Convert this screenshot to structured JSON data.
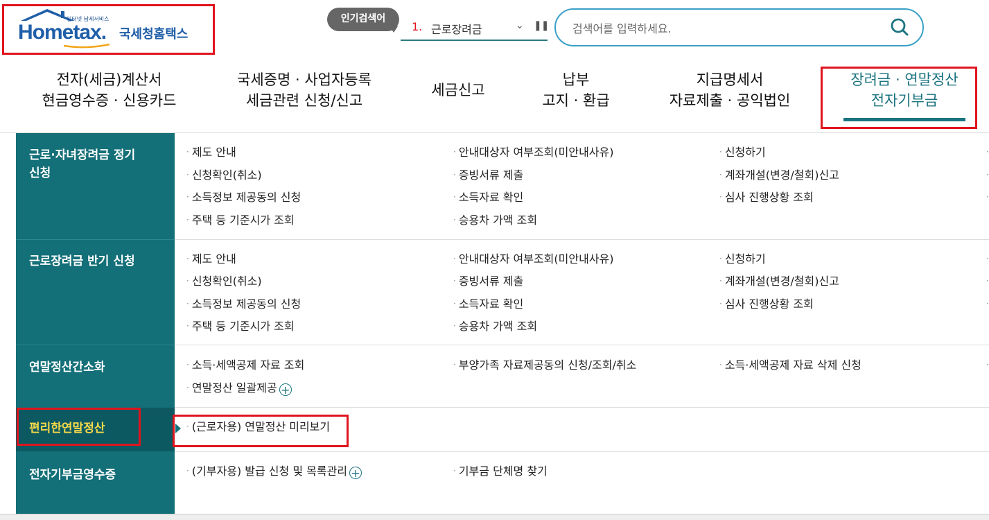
{
  "brand": {
    "sub": "인터넷 납세서비스",
    "name_en": "Hometax.",
    "name_kr": "국세청홈택스"
  },
  "popular": {
    "badge": "인기검색어",
    "rank": "1.",
    "term": "근로장려금"
  },
  "search": {
    "placeholder": "검색어를 입력하세요."
  },
  "nav": [
    {
      "line1": "전자(세금)계산서",
      "line2": "현금영수증 · 신용카드"
    },
    {
      "line1": "국세증명 · 사업자등록",
      "line2": "세금관련 신청/신고"
    },
    {
      "line1": "세금신고",
      "line2": ""
    },
    {
      "line1": "납부",
      "line2": "고지 · 환급"
    },
    {
      "line1": "지급명세서",
      "line2": "자료제출 · 공익법인"
    },
    {
      "line1": "장려금 · 연말정산",
      "line2": "전자기부금"
    }
  ],
  "menu": {
    "categories": [
      {
        "label_1": "근로·자녀장려금 정기",
        "label_2": "신청"
      },
      {
        "label_1": "근로장려금 반기 신청"
      },
      {
        "label_1": "연말정산간소화"
      },
      {
        "label_1": "편리한연말정산"
      },
      {
        "label_1": "전자기부금영수증"
      }
    ],
    "links": {
      "c1": [
        "제도 안내",
        "안내대상자 여부조회(미안내사유)",
        "신청하기",
        "신청확인(취소)",
        "증빙서류 제출",
        "계좌개설(변경/철회)신고",
        "소득정보 제공동의 신청",
        "소득자료 확인",
        "심사 진행상황 조회",
        "주택 등 기준시가 조회",
        "승용차 가액 조회"
      ],
      "c2": [
        "제도 안내",
        "안내대상자 여부조회(미안내사유)",
        "신청하기",
        "신청확인(취소)",
        "증빙서류 제출",
        "계좌개설(변경/철회)신고",
        "소득정보 제공동의 신청",
        "소득자료 확인",
        "심사 진행상황 조회",
        "주택 등 기준시가 조회",
        "승용차 가액 조회"
      ],
      "c3": [
        "소득·세액공제 자료 조회",
        "부양가족 자료제공동의 신청/조회/취소",
        "소득·세액공제 자료 삭제 신청",
        "연말정산 일괄제공"
      ],
      "c4": [
        "(근로자용) 연말정산 미리보기"
      ],
      "c5": [
        "(기부자용) 발급 신청 및 목록관리",
        "기부금 단체명 찾기"
      ]
    }
  },
  "colors": {
    "teal": "#136f78",
    "highlight": "#e0141e",
    "active_text": "#f5d94a"
  }
}
